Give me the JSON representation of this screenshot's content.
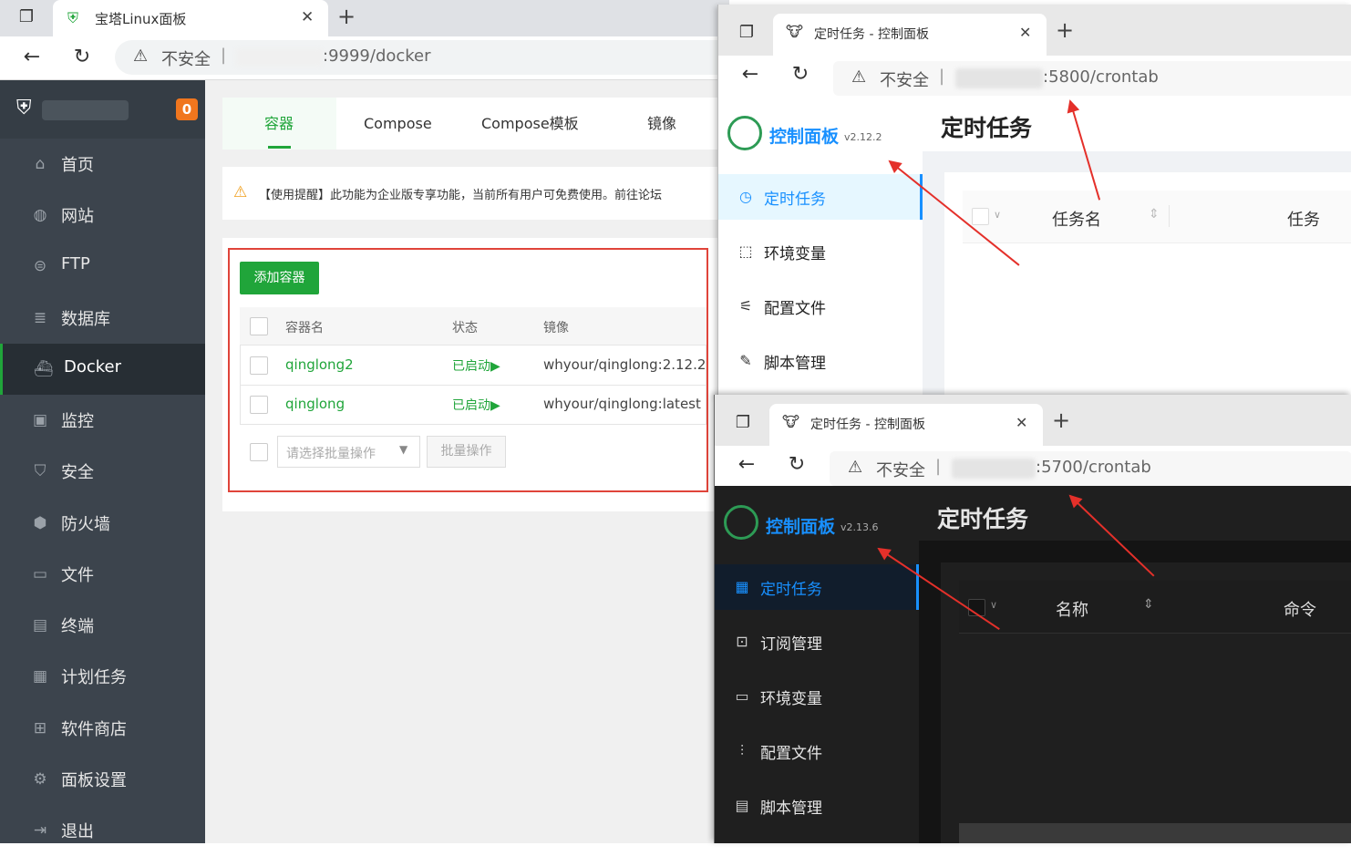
{
  "browser1": {
    "tab_title": "宝塔Linux面板",
    "security": "不安全",
    "url": ":9999/docker",
    "badge": "0",
    "sidebar": [
      {
        "label": "首页",
        "icon": "home-icon",
        "glyph": "⌂"
      },
      {
        "label": "网站",
        "icon": "globe-icon",
        "glyph": "◍"
      },
      {
        "label": "FTP",
        "icon": "ftp-icon",
        "glyph": "⊜"
      },
      {
        "label": "数据库",
        "icon": "database-icon",
        "glyph": "≣"
      },
      {
        "label": "Docker",
        "icon": "docker-icon",
        "glyph": "⛴"
      },
      {
        "label": "监控",
        "icon": "monitor-icon",
        "glyph": "▣"
      },
      {
        "label": "安全",
        "icon": "shield-icon",
        "glyph": "⛉"
      },
      {
        "label": "防火墙",
        "icon": "firewall-icon",
        "glyph": "⬢"
      },
      {
        "label": "文件",
        "icon": "folder-icon",
        "glyph": "▭"
      },
      {
        "label": "终端",
        "icon": "terminal-icon",
        "glyph": "▤"
      },
      {
        "label": "计划任务",
        "icon": "calendar-icon",
        "glyph": "▦"
      },
      {
        "label": "软件商店",
        "icon": "apps-icon",
        "glyph": "⊞"
      },
      {
        "label": "面板设置",
        "icon": "gear-icon",
        "glyph": "⚙"
      },
      {
        "label": "退出",
        "icon": "logout-icon",
        "glyph": "⇥"
      }
    ],
    "tabs": [
      "容器",
      "Compose",
      "Compose模板",
      "镜像"
    ],
    "warning": "【使用提醒】此功能为企业版专享功能，当前所有用户可免费使用。前往论坛",
    "add_button": "添加容器",
    "table": {
      "headers": [
        "容器名",
        "状态",
        "镜像"
      ],
      "rows": [
        {
          "name": "qinglong2",
          "status": "已启动▶",
          "image": "whyour/qinglong:2.12.2"
        },
        {
          "name": "qinglong",
          "status": "已启动▶",
          "image": "whyour/qinglong:latest"
        }
      ]
    },
    "batch_placeholder": "请选择批量操作",
    "batch_button": "批量操作"
  },
  "browser2": {
    "tab_title": "定时任务 - 控制面板",
    "security": "不安全",
    "url": ":5800/crontab",
    "brand": "控制面板",
    "version": "v2.12.2",
    "page_title": "定时任务",
    "menu": [
      {
        "label": "定时任务",
        "icon": "clock-icon",
        "glyph": "◷"
      },
      {
        "label": "环境变量",
        "icon": "env-icon",
        "glyph": "⬚"
      },
      {
        "label": "配置文件",
        "icon": "config-icon",
        "glyph": "⚟"
      },
      {
        "label": "脚本管理",
        "icon": "edit-icon",
        "glyph": "✎"
      }
    ],
    "columns": [
      "任务名",
      "任务"
    ]
  },
  "browser3": {
    "tab_title": "定时任务 - 控制面板",
    "security": "不安全",
    "url": ":5700/crontab",
    "brand": "控制面板",
    "version": "v2.13.6",
    "page_title": "定时任务",
    "menu": [
      {
        "label": "定时任务",
        "icon": "calendar-icon",
        "glyph": "▦"
      },
      {
        "label": "订阅管理",
        "icon": "subscribe-icon",
        "glyph": "⊡"
      },
      {
        "label": "环境变量",
        "icon": "env-icon",
        "glyph": "▭"
      },
      {
        "label": "配置文件",
        "icon": "sliders-icon",
        "glyph": "⫶"
      },
      {
        "label": "脚本管理",
        "icon": "script-icon",
        "glyph": "▤"
      }
    ],
    "columns": [
      "名称",
      "命令"
    ]
  },
  "colors": {
    "bt_green": "#20a53a",
    "ql_blue": "#1890ff",
    "arrow_red": "#e4302a",
    "bt_sidebar": "#3c444d",
    "ql_dark": "#1f1f1f"
  }
}
